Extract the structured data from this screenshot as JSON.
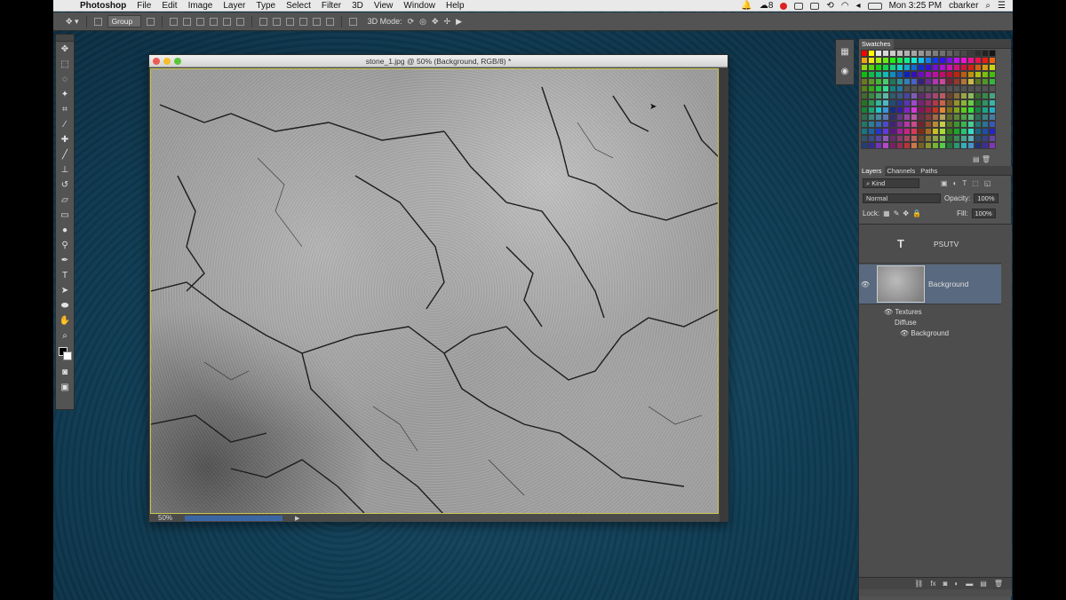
{
  "menubar": {
    "app_name": "Photoshop",
    "menus": [
      "File",
      "Edit",
      "Image",
      "Layer",
      "Type",
      "Select",
      "Filter",
      "3D",
      "View",
      "Window",
      "Help"
    ],
    "clock": "Mon 3:25 PM",
    "user": "cbarker",
    "badge_count": "8"
  },
  "options_bar": {
    "auto_select_value": "Group",
    "mode_label": "3D Mode:"
  },
  "document": {
    "title": "stone_1.jpg @ 50% (Background, RGB/8) *",
    "zoom": "50%"
  },
  "swatches_panel": {
    "tab": "Swatches"
  },
  "layers_panel": {
    "tabs": [
      "Layers",
      "Channels",
      "Paths"
    ],
    "filter_kind": "Kind",
    "blend_mode": "Normal",
    "opacity_label": "Opacity:",
    "opacity_value": "100%",
    "lock_label": "Lock:",
    "fill_label": "Fill:",
    "fill_value": "100%",
    "layers": [
      {
        "name": "PSUTV",
        "type": "text"
      },
      {
        "name": "Background",
        "type": "image"
      }
    ],
    "effects": {
      "group": "Textures",
      "diffuse": "Diffuse",
      "sub": "Background"
    }
  },
  "colors": {
    "desktop": "#103d55",
    "selected_layer": "#59697f",
    "progress": "#3b66a6"
  }
}
